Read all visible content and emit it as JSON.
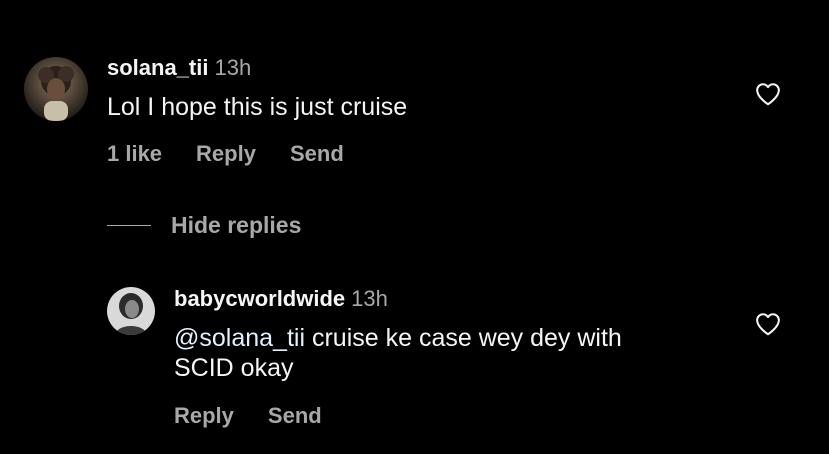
{
  "colors": {
    "background": "#000000",
    "text_primary": "#f5f5f5",
    "text_secondary": "#a8a8a8"
  },
  "comments": [
    {
      "username": "solana_tii",
      "time": "13h",
      "text": "Lol I hope this is just cruise",
      "likes_label": "1 like",
      "reply_label": "Reply",
      "send_label": "Send",
      "like_icon": "heart-outline-icon"
    }
  ],
  "thread": {
    "hide_replies_label": "Hide replies"
  },
  "replies": [
    {
      "username": "babycworldwide",
      "time": "13h",
      "mention": "@solana_tii",
      "text_line1": " cruise ke case wey dey with",
      "text_line2": "SCID okay",
      "reply_label": "Reply",
      "send_label": "Send",
      "like_icon": "heart-outline-icon"
    }
  ]
}
